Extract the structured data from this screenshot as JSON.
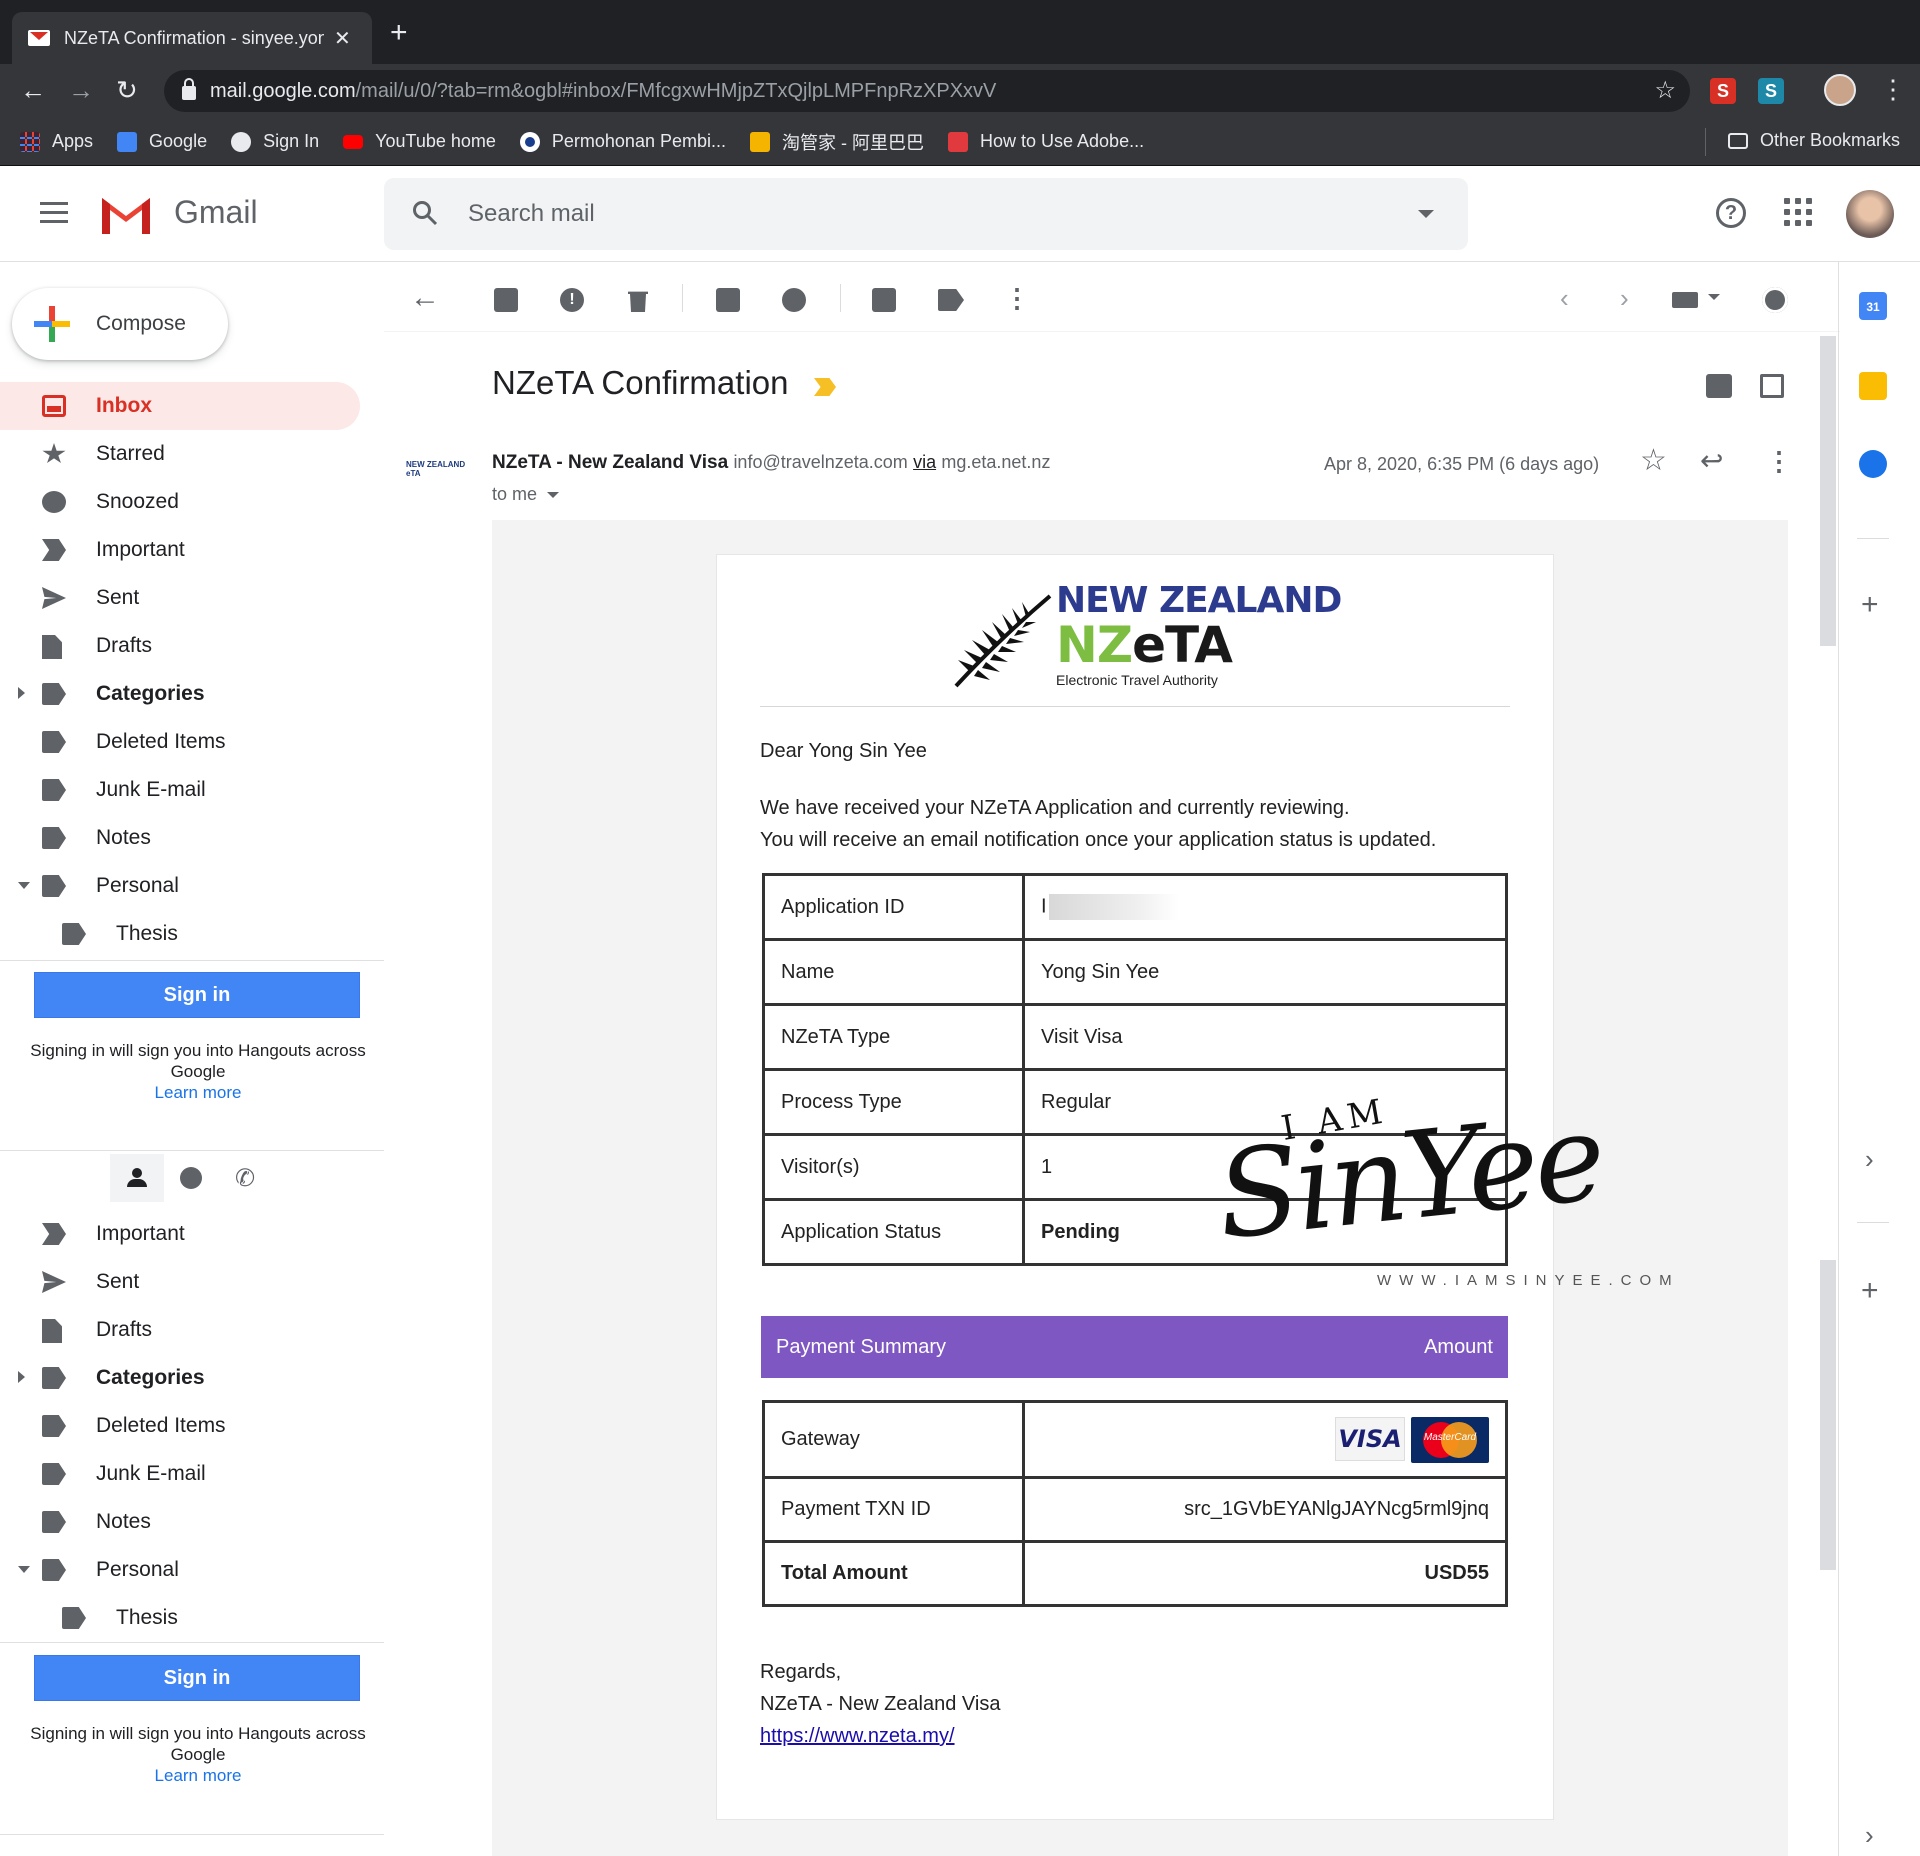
{
  "browser": {
    "tab_title": "NZeTA Confirmation - sinyee.yon",
    "url_host": "mail.google.com",
    "url_path": "/mail/u/0/?tab=rm&ogbl#inbox/FMfcgxwHMjpZTxQjlpLMPFnpRzXPXxvV",
    "bookmarks": [
      "Apps",
      "Google",
      "Sign In",
      "YouTube home",
      "Permohonan Pembi...",
      "淘管家 - 阿里巴巴",
      "How to Use Adobe..."
    ],
    "other_bookmarks": "Other Bookmarks",
    "extensions": [
      "S",
      "S"
    ],
    "colors": {
      "ext_red": "#d93025",
      "ext_teal": "#1e88a8"
    }
  },
  "gmail": {
    "brand": "Gmail",
    "search_placeholder": "Search mail",
    "compose": "Compose",
    "nav": [
      {
        "label": "Inbox",
        "icon": "inbox-icon",
        "active": true
      },
      {
        "label": "Starred",
        "icon": "star-icon"
      },
      {
        "label": "Snoozed",
        "icon": "clock-icon"
      },
      {
        "label": "Important",
        "icon": "important-icon"
      },
      {
        "label": "Sent",
        "icon": "send-icon"
      },
      {
        "label": "Drafts",
        "icon": "draft-icon"
      },
      {
        "label": "Categories",
        "icon": "label-icon",
        "expandable": "collapsed"
      },
      {
        "label": "Deleted Items",
        "icon": "label-icon"
      },
      {
        "label": "Junk E-mail",
        "icon": "label-icon"
      },
      {
        "label": "Notes",
        "icon": "label-icon"
      },
      {
        "label": "Personal",
        "icon": "label-icon",
        "expandable": "expanded"
      },
      {
        "label": "Thesis",
        "icon": "label-icon",
        "nested": true
      }
    ],
    "nav2": [
      {
        "label": "Important",
        "icon": "important-icon"
      },
      {
        "label": "Sent",
        "icon": "send-icon"
      },
      {
        "label": "Drafts",
        "icon": "draft-icon"
      },
      {
        "label": "Categories",
        "icon": "label-icon",
        "expandable": "collapsed"
      },
      {
        "label": "Deleted Items",
        "icon": "label-icon"
      },
      {
        "label": "Junk E-mail",
        "icon": "label-icon"
      },
      {
        "label": "Notes",
        "icon": "label-icon"
      },
      {
        "label": "Personal",
        "icon": "label-icon",
        "expandable": "expanded"
      },
      {
        "label": "Thesis",
        "icon": "label-icon",
        "nested": true
      }
    ],
    "hangouts": {
      "signin_label": "Sign in",
      "note": "Signing in will sign you into Hangouts across Google",
      "learn_more": "Learn more"
    }
  },
  "message": {
    "subject": "NZeTA Confirmation",
    "sender_name": "NZeTA - New Zealand Visa",
    "sender_email": "info@travelnzeta.com",
    "via_label": "via",
    "via_domain": "mg.eta.net.nz",
    "to": "to me",
    "date": "Apr 8, 2020, 6:35 PM (6 days ago)",
    "avatar_text": "NEW ZEALAND eTA"
  },
  "email": {
    "logo_title": "NEW ZEALAND",
    "logo_brand_green": "NZ",
    "logo_brand_dark": "eTA",
    "logo_sub": "Electronic Travel Authority",
    "greeting": "Dear Yong Sin Yee",
    "line1": "We have received your NZeTA Application and currently reviewing.",
    "line2": "You will receive an email notification once your application status is updated.",
    "details": [
      {
        "key": "Application ID",
        "value": "I",
        "redacted": true
      },
      {
        "key": "Name",
        "value": "Yong Sin Yee"
      },
      {
        "key": "NZeTA Type",
        "value": "Visit Visa"
      },
      {
        "key": "Process Type",
        "value": "Regular"
      },
      {
        "key": "Visitor(s)",
        "value": "1"
      },
      {
        "key": "Application Status",
        "value": "Pending",
        "bold": true
      }
    ],
    "payment_header": "Payment Summary",
    "amount_header": "Amount",
    "gateway_label": "Gateway",
    "visa_text": "VISA",
    "mastercard_text": "MasterCard",
    "txn_label": "Payment TXN ID",
    "txn_value": "src_1GVbEYANlgJAYNcg5rml9jnq",
    "total_label": "Total Amount",
    "total_value": "USD55",
    "regards": "Regards,",
    "signature": "NZeTA - New Zealand Visa",
    "link": "https://www.nzeta.my/",
    "accent_color": "#7e57c2"
  },
  "watermark": {
    "line1": "I AM",
    "script": "SinYee",
    "site": "WWW.IAMSINYEE.COM"
  },
  "side_panel": {
    "calendar_day": "31"
  }
}
